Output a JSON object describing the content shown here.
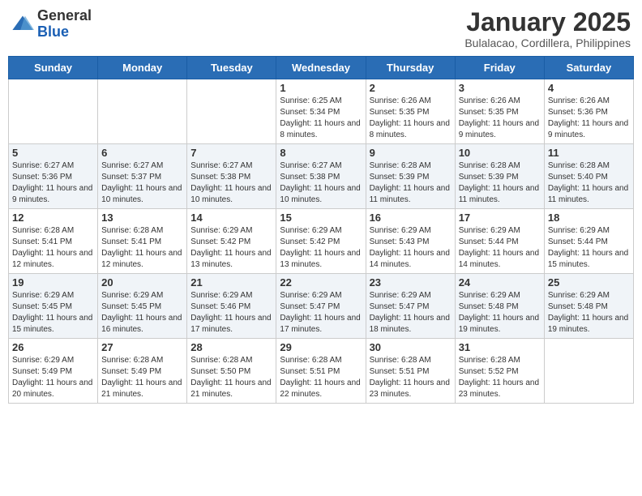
{
  "header": {
    "logo_general": "General",
    "logo_blue": "Blue",
    "month_title": "January 2025",
    "location": "Bulalacao, Cordillera, Philippines"
  },
  "weekdays": [
    "Sunday",
    "Monday",
    "Tuesday",
    "Wednesday",
    "Thursday",
    "Friday",
    "Saturday"
  ],
  "weeks": [
    [
      {
        "day": "",
        "sunrise": "",
        "sunset": "",
        "daylight": ""
      },
      {
        "day": "",
        "sunrise": "",
        "sunset": "",
        "daylight": ""
      },
      {
        "day": "",
        "sunrise": "",
        "sunset": "",
        "daylight": ""
      },
      {
        "day": "1",
        "sunrise": "6:25 AM",
        "sunset": "5:34 PM",
        "daylight": "11 hours and 8 minutes."
      },
      {
        "day": "2",
        "sunrise": "6:26 AM",
        "sunset": "5:35 PM",
        "daylight": "11 hours and 8 minutes."
      },
      {
        "day": "3",
        "sunrise": "6:26 AM",
        "sunset": "5:35 PM",
        "daylight": "11 hours and 9 minutes."
      },
      {
        "day": "4",
        "sunrise": "6:26 AM",
        "sunset": "5:36 PM",
        "daylight": "11 hours and 9 minutes."
      }
    ],
    [
      {
        "day": "5",
        "sunrise": "6:27 AM",
        "sunset": "5:36 PM",
        "daylight": "11 hours and 9 minutes."
      },
      {
        "day": "6",
        "sunrise": "6:27 AM",
        "sunset": "5:37 PM",
        "daylight": "11 hours and 10 minutes."
      },
      {
        "day": "7",
        "sunrise": "6:27 AM",
        "sunset": "5:38 PM",
        "daylight": "11 hours and 10 minutes."
      },
      {
        "day": "8",
        "sunrise": "6:27 AM",
        "sunset": "5:38 PM",
        "daylight": "11 hours and 10 minutes."
      },
      {
        "day": "9",
        "sunrise": "6:28 AM",
        "sunset": "5:39 PM",
        "daylight": "11 hours and 11 minutes."
      },
      {
        "day": "10",
        "sunrise": "6:28 AM",
        "sunset": "5:39 PM",
        "daylight": "11 hours and 11 minutes."
      },
      {
        "day": "11",
        "sunrise": "6:28 AM",
        "sunset": "5:40 PM",
        "daylight": "11 hours and 11 minutes."
      }
    ],
    [
      {
        "day": "12",
        "sunrise": "6:28 AM",
        "sunset": "5:41 PM",
        "daylight": "11 hours and 12 minutes."
      },
      {
        "day": "13",
        "sunrise": "6:28 AM",
        "sunset": "5:41 PM",
        "daylight": "11 hours and 12 minutes."
      },
      {
        "day": "14",
        "sunrise": "6:29 AM",
        "sunset": "5:42 PM",
        "daylight": "11 hours and 13 minutes."
      },
      {
        "day": "15",
        "sunrise": "6:29 AM",
        "sunset": "5:42 PM",
        "daylight": "11 hours and 13 minutes."
      },
      {
        "day": "16",
        "sunrise": "6:29 AM",
        "sunset": "5:43 PM",
        "daylight": "11 hours and 14 minutes."
      },
      {
        "day": "17",
        "sunrise": "6:29 AM",
        "sunset": "5:44 PM",
        "daylight": "11 hours and 14 minutes."
      },
      {
        "day": "18",
        "sunrise": "6:29 AM",
        "sunset": "5:44 PM",
        "daylight": "11 hours and 15 minutes."
      }
    ],
    [
      {
        "day": "19",
        "sunrise": "6:29 AM",
        "sunset": "5:45 PM",
        "daylight": "11 hours and 15 minutes."
      },
      {
        "day": "20",
        "sunrise": "6:29 AM",
        "sunset": "5:45 PM",
        "daylight": "11 hours and 16 minutes."
      },
      {
        "day": "21",
        "sunrise": "6:29 AM",
        "sunset": "5:46 PM",
        "daylight": "11 hours and 17 minutes."
      },
      {
        "day": "22",
        "sunrise": "6:29 AM",
        "sunset": "5:47 PM",
        "daylight": "11 hours and 17 minutes."
      },
      {
        "day": "23",
        "sunrise": "6:29 AM",
        "sunset": "5:47 PM",
        "daylight": "11 hours and 18 minutes."
      },
      {
        "day": "24",
        "sunrise": "6:29 AM",
        "sunset": "5:48 PM",
        "daylight": "11 hours and 19 minutes."
      },
      {
        "day": "25",
        "sunrise": "6:29 AM",
        "sunset": "5:48 PM",
        "daylight": "11 hours and 19 minutes."
      }
    ],
    [
      {
        "day": "26",
        "sunrise": "6:29 AM",
        "sunset": "5:49 PM",
        "daylight": "11 hours and 20 minutes."
      },
      {
        "day": "27",
        "sunrise": "6:28 AM",
        "sunset": "5:49 PM",
        "daylight": "11 hours and 21 minutes."
      },
      {
        "day": "28",
        "sunrise": "6:28 AM",
        "sunset": "5:50 PM",
        "daylight": "11 hours and 21 minutes."
      },
      {
        "day": "29",
        "sunrise": "6:28 AM",
        "sunset": "5:51 PM",
        "daylight": "11 hours and 22 minutes."
      },
      {
        "day": "30",
        "sunrise": "6:28 AM",
        "sunset": "5:51 PM",
        "daylight": "11 hours and 23 minutes."
      },
      {
        "day": "31",
        "sunrise": "6:28 AM",
        "sunset": "5:52 PM",
        "daylight": "11 hours and 23 minutes."
      },
      {
        "day": "",
        "sunrise": "",
        "sunset": "",
        "daylight": ""
      }
    ]
  ]
}
